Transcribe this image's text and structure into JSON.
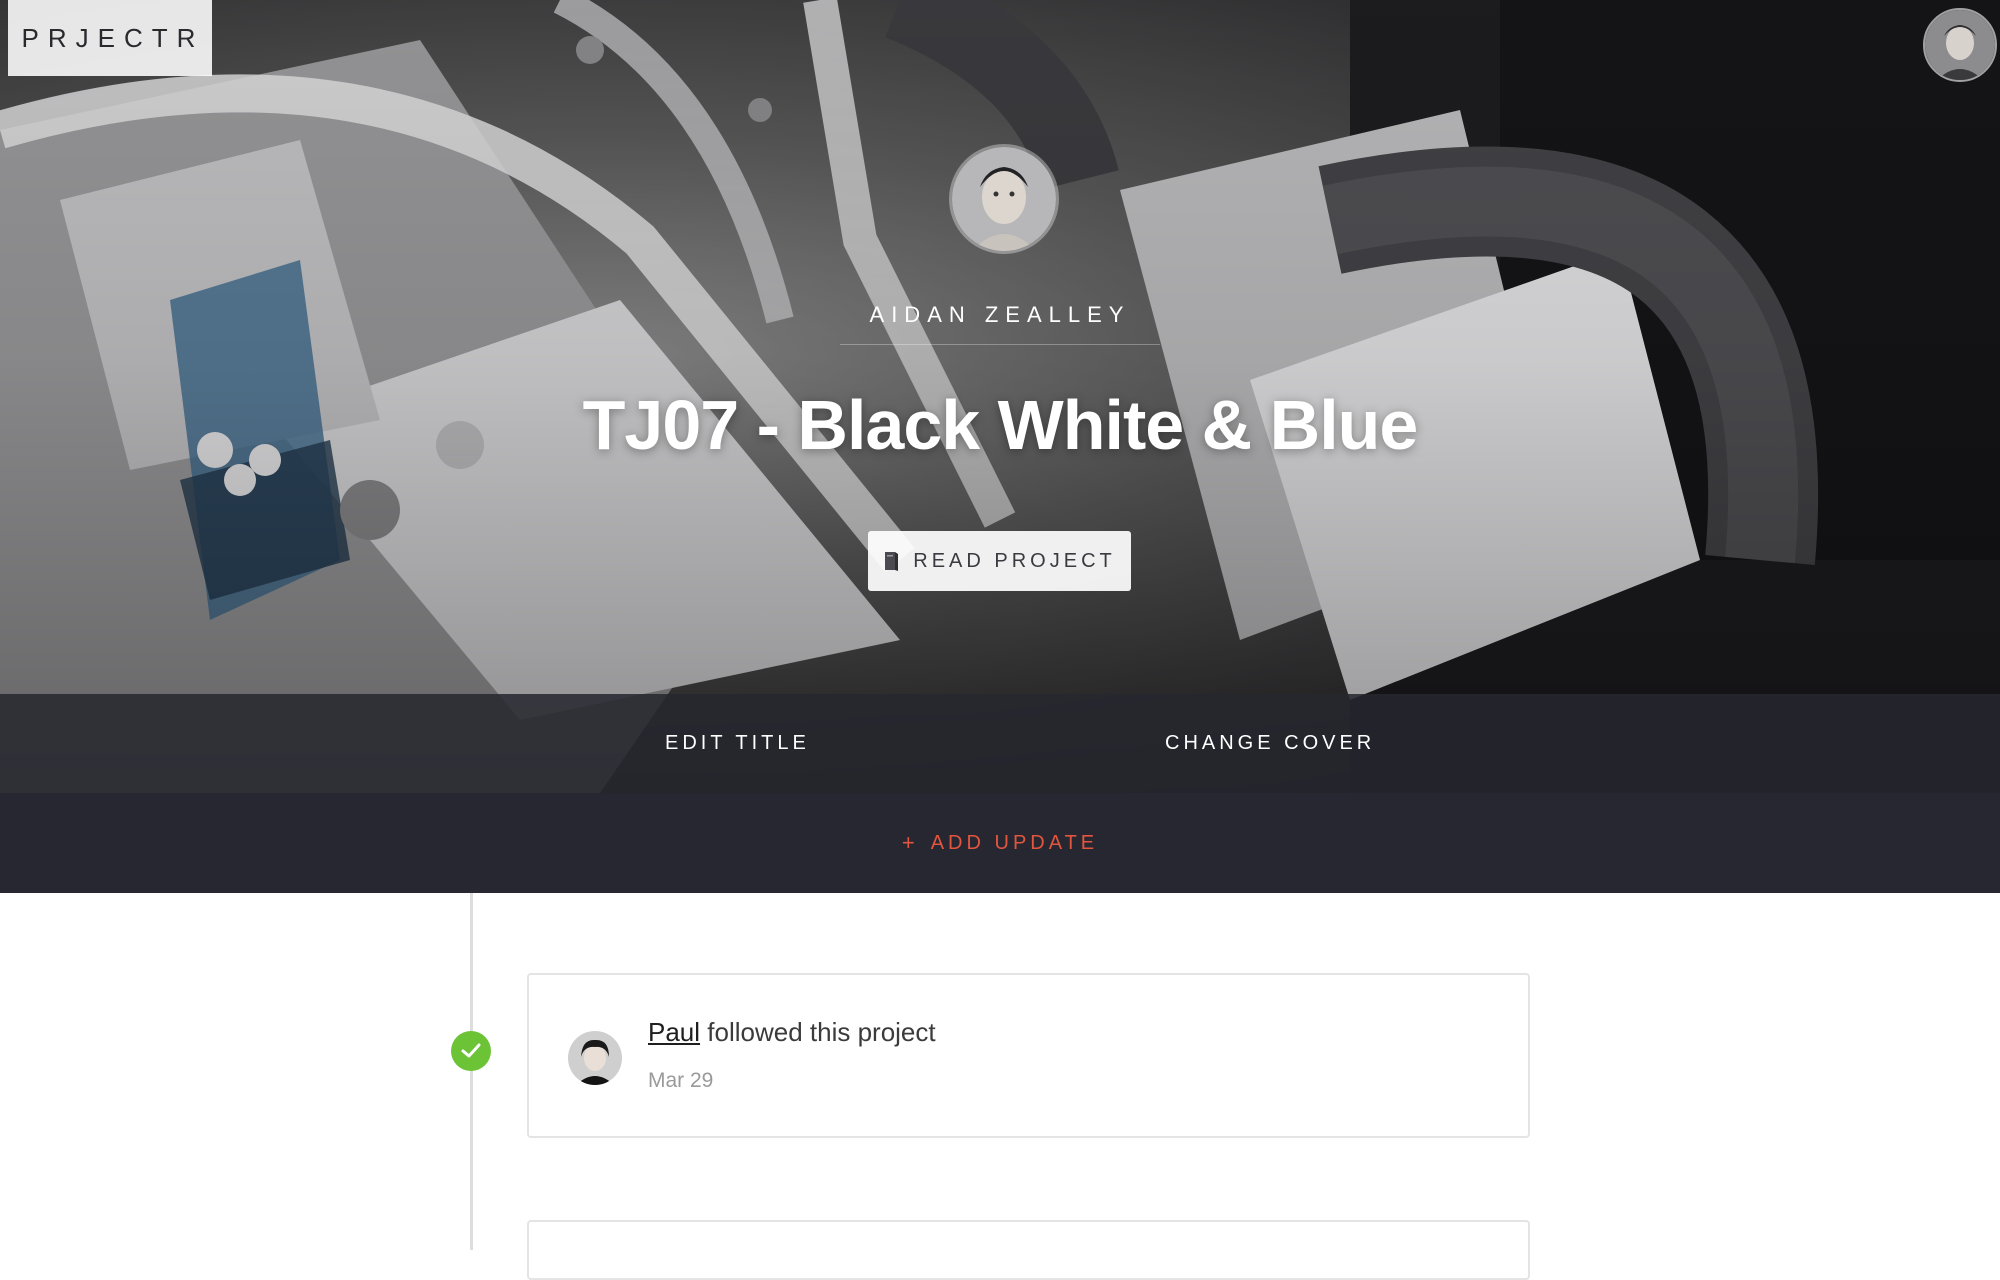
{
  "brand": {
    "logo_text": "PRJECTR"
  },
  "header": {
    "user_avatar_icon": "user-avatar"
  },
  "project": {
    "author_name": "AIDAN ZEALLEY",
    "title": "TJ07 - Black White & Blue",
    "read_button_label": "READ PROJECT",
    "read_button_icon": "book-icon"
  },
  "edit_bar": {
    "edit_title_label": "EDIT TITLE",
    "change_cover_label": "CHANGE COVER"
  },
  "add_update": {
    "icon": "+",
    "label": "ADD UPDATE",
    "color": "#e2553f"
  },
  "timeline": {
    "status_color": "#6cc335",
    "items": [
      {
        "user": "Paul",
        "action": "followed this project",
        "date": "Mar 29"
      }
    ]
  }
}
